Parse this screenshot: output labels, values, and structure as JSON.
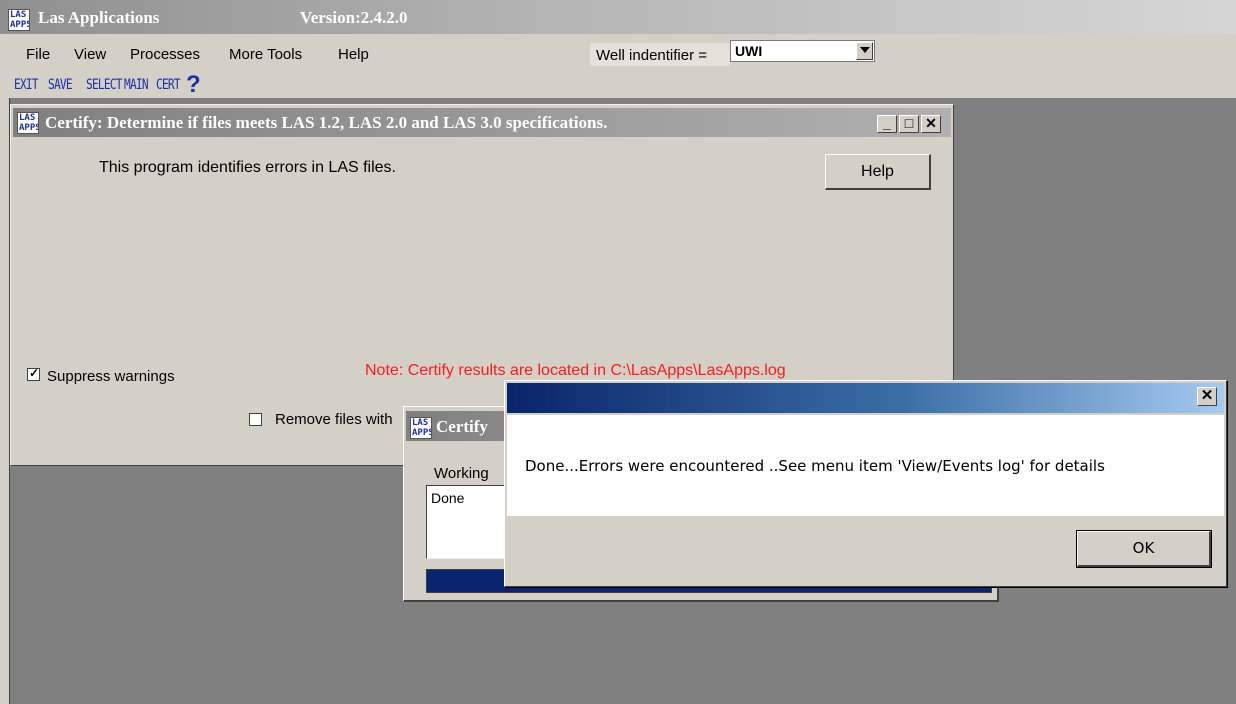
{
  "app": {
    "title": "Las Applications",
    "version": "Version:2.4.2.0",
    "logo_line1": "LAS",
    "logo_line2": "APPS"
  },
  "menu": {
    "items": [
      "File",
      "View",
      "Processes",
      "More Tools",
      "Help"
    ],
    "well_label": "Well indentifier =",
    "well_value": "UWI"
  },
  "toolbar": {
    "buttons": [
      "EXIT",
      "SAVE",
      "SELECT",
      "MAIN",
      "CERT"
    ],
    "help_icon": "question-mark-icon"
  },
  "certify": {
    "title": "Certify: Determine if files meets LAS 1.2, LAS 2.0 and LAS 3.0 specifications.",
    "minimize": "_",
    "maximize": "□",
    "close": "✕",
    "description": "This program identifies errors in LAS files.",
    "help_label": "Help",
    "suppress_label": "Suppress warnings",
    "suppress_checked": true,
    "note": "Note: Certify results are located in C:\\LasApps\\LasApps.log",
    "remove_label": "Remove files with",
    "remove_checked": false
  },
  "progress": {
    "title": "Certify",
    "working_label": "Working",
    "list_item": "Done",
    "progress_fraction": 1.0
  },
  "dialog": {
    "close": "✕",
    "message": "Done...Errors were encountered ..See menu item 'View/Events log' for details",
    "ok_label": "OK"
  },
  "colors": {
    "note_red": "#ff1a1a",
    "dialog_title_start": "#0a246a",
    "dialog_title_end": "#a6caf0",
    "progress_fill": "#0a2470"
  }
}
